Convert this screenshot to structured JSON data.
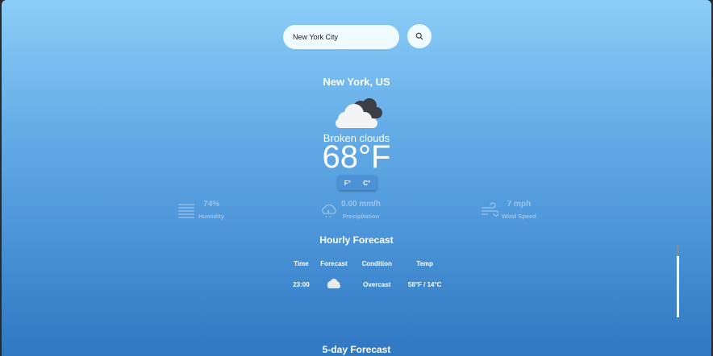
{
  "search": {
    "value": "New York City",
    "icon": "search-icon"
  },
  "location": {
    "city": "New York, US"
  },
  "current": {
    "icon": "broken-clouds-icon",
    "condition": "Broken clouds",
    "temperature": "68°F"
  },
  "units": {
    "fahrenheit_label": "F°",
    "celsius_label": "C°"
  },
  "stats": [
    {
      "icon": "humidity-icon",
      "value": "74%",
      "label": "Humidity"
    },
    {
      "icon": "precipitation-icon",
      "value": "0.00 mm/h",
      "label": "Precipitation"
    },
    {
      "icon": "wind-icon",
      "value": "7 mph",
      "label": "Wind Speed"
    }
  ],
  "hourly": {
    "title": "Hourly Forecast",
    "columns": [
      "Time",
      "Forecast",
      "Condition",
      "Temp"
    ],
    "rows": [
      {
        "time": "23:00",
        "icon": "overcast-cloud-icon",
        "condition": "Overcast",
        "temp": "58°F / 14°C"
      }
    ]
  },
  "daily": {
    "title": "5-day Forecast"
  },
  "colors": {
    "background_top": "#8bcdf7",
    "background_bottom": "#2f78c2",
    "toggle": "#4d92d6"
  }
}
